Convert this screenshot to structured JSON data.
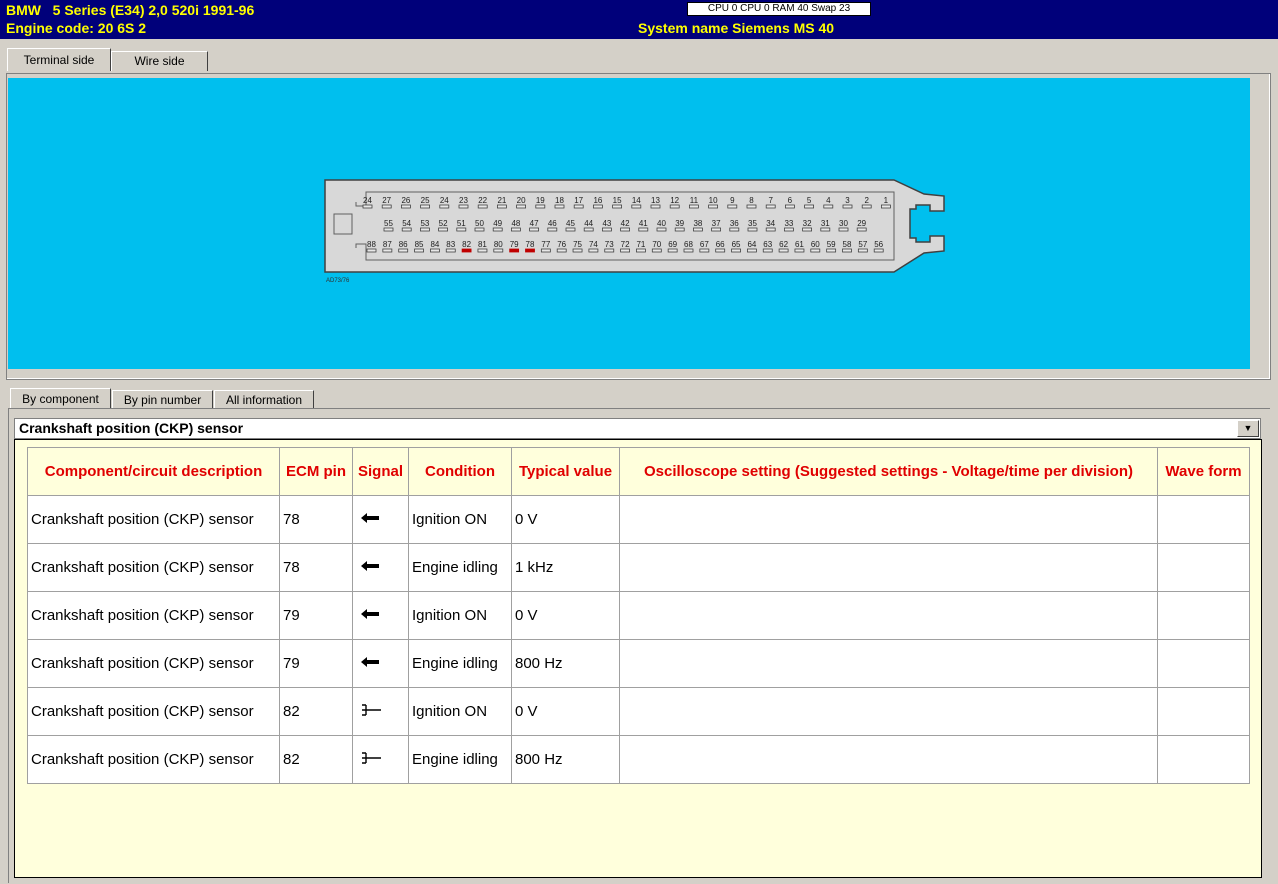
{
  "header": {
    "line1": "BMW   5 Series (E34) 2,0 520i 1991-96",
    "line2": "Engine code: 20 6S 2",
    "system_name": "System name Siemens MS 40",
    "cpu_status": "CPU 0  CPU 0  RAM 40 Swap 23"
  },
  "view_tabs": [
    "Terminal side",
    "Wire side"
  ],
  "connector": {
    "part_number": "AD73/76",
    "row1_pins": [
      "24",
      "27",
      "26",
      "25",
      "24",
      "23",
      "22",
      "21",
      "20",
      "19",
      "18",
      "17",
      "16",
      "15",
      "14",
      "13",
      "12",
      "11",
      "10",
      "9",
      "8",
      "7",
      "6",
      "5",
      "4",
      "3",
      "2",
      "1"
    ],
    "row2_pins": [
      "55",
      "54",
      "53",
      "52",
      "51",
      "50",
      "49",
      "48",
      "47",
      "46",
      "45",
      "44",
      "43",
      "42",
      "41",
      "40",
      "39",
      "38",
      "37",
      "36",
      "35",
      "34",
      "33",
      "32",
      "31",
      "30",
      "29"
    ],
    "row3_pins": [
      "88",
      "87",
      "86",
      "85",
      "84",
      "83",
      "82",
      "81",
      "80",
      "79",
      "78",
      "77",
      "76",
      "75",
      "74",
      "73",
      "72",
      "71",
      "70",
      "69",
      "68",
      "67",
      "66",
      "65",
      "64",
      "63",
      "62",
      "61",
      "60",
      "59",
      "58",
      "57",
      "56"
    ],
    "highlighted_pins": [
      "82",
      "79",
      "78"
    ],
    "highlight_color": "#c00000",
    "background_color": "#00bfee"
  },
  "info_tabs": [
    "By component",
    "By pin number",
    "All information"
  ],
  "component_select": "Crankshaft position (CKP) sensor",
  "table": {
    "headers": [
      "Component/circuit description",
      "ECM pin",
      "Signal",
      "Condition",
      "Typical value",
      "Oscilloscope setting (Suggested settings - Voltage/time per division)",
      "Wave form"
    ],
    "rows": [
      {
        "desc": "Crankshaft position (CKP) sensor",
        "pin": "78",
        "signal": "input-arrow",
        "condition": "Ignition ON",
        "value": "0 V",
        "osc": "",
        "wave": ""
      },
      {
        "desc": "Crankshaft position (CKP) sensor",
        "pin": "78",
        "signal": "input-arrow",
        "condition": "Engine idling",
        "value": "1 kHz",
        "osc": "",
        "wave": ""
      },
      {
        "desc": "Crankshaft position (CKP) sensor",
        "pin": "79",
        "signal": "input-arrow",
        "condition": "Ignition ON",
        "value": "0 V",
        "osc": "",
        "wave": ""
      },
      {
        "desc": "Crankshaft position (CKP) sensor",
        "pin": "79",
        "signal": "input-arrow",
        "condition": "Engine idling",
        "value": "800 Hz",
        "osc": "",
        "wave": ""
      },
      {
        "desc": "Crankshaft position (CKP) sensor",
        "pin": "82",
        "signal": "ground-symbol",
        "condition": "Ignition ON",
        "value": "0 V",
        "osc": "",
        "wave": ""
      },
      {
        "desc": "Crankshaft position (CKP) sensor",
        "pin": "82",
        "signal": "ground-symbol",
        "condition": "Engine idling",
        "value": "800 Hz",
        "osc": "",
        "wave": ""
      }
    ]
  }
}
